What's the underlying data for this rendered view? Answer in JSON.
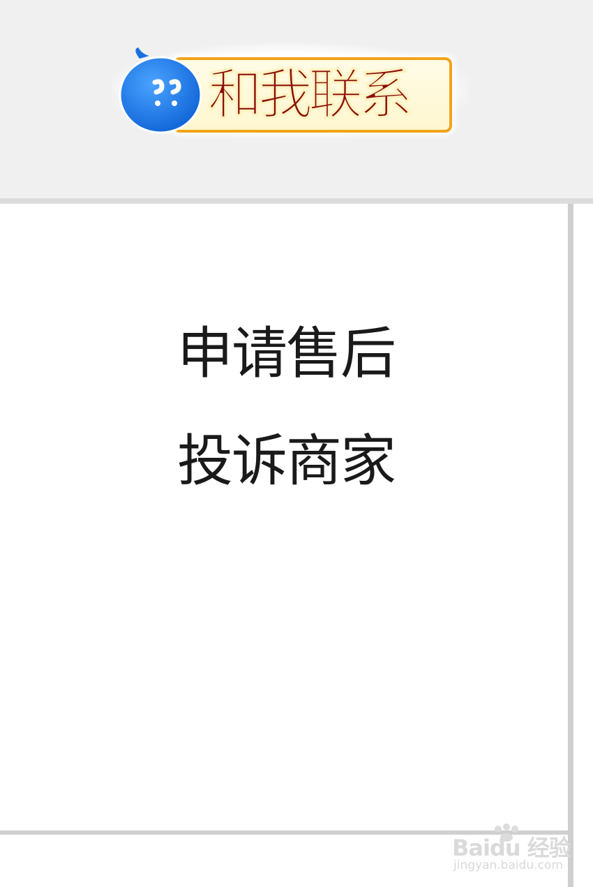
{
  "contact": {
    "label": "和我联系",
    "icon": "chat-bubble-icon"
  },
  "menu": {
    "items": [
      {
        "label": "申请售后"
      },
      {
        "label": "投诉商家"
      }
    ]
  },
  "watermark": {
    "logo": "Baidu 经验",
    "url": "jingyan.baidu.com"
  },
  "colors": {
    "contact_text": "#8b0d0d",
    "contact_border": "#f2a31a",
    "bubble_blue": "#1e7be8",
    "top_band": "#f0f0f0"
  }
}
